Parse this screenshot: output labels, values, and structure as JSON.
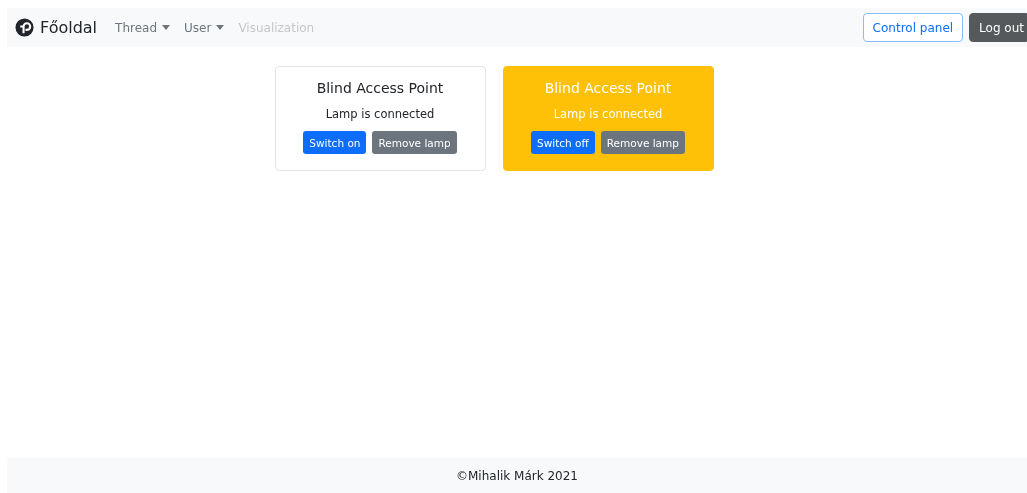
{
  "navbar": {
    "brand": "Főoldal",
    "links": [
      {
        "label": "Thread",
        "kind": "dropdown",
        "disabled": false
      },
      {
        "label": "User",
        "kind": "dropdown",
        "disabled": false
      },
      {
        "label": "Visualization",
        "kind": "link",
        "disabled": true
      }
    ],
    "buttons": [
      {
        "label": "Control panel",
        "kind": "outline"
      },
      {
        "label": "Log out",
        "kind": "dark"
      }
    ]
  },
  "lamps": [
    {
      "title": "Blind Access Point",
      "status": "Lamp is connected",
      "on": false,
      "switch_label": "Switch on",
      "remove_label": "Remove lamp"
    },
    {
      "title": "Blind Access Point",
      "status": "Lamp is connected",
      "on": true,
      "switch_label": "Switch off",
      "remove_label": "Remove lamp"
    }
  ],
  "footer": "©Mihalik Márk 2021"
}
